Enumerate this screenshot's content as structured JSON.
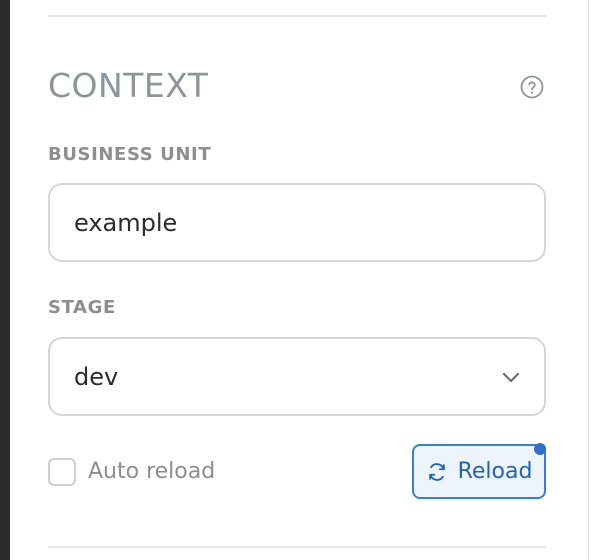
{
  "context": {
    "title": "CONTEXT",
    "help_icon": "question-circle-icon",
    "business_unit": {
      "label": "BUSINESS UNIT",
      "value": "example"
    },
    "stage": {
      "label": "STAGE",
      "selected": "dev",
      "icon": "chevron-down-icon"
    },
    "auto_reload": {
      "label": "Auto reload",
      "checked": false
    },
    "reload_button": {
      "label": "Reload",
      "icon": "refresh-icon",
      "accent": "#3b7fd1",
      "has_badge": true
    }
  }
}
